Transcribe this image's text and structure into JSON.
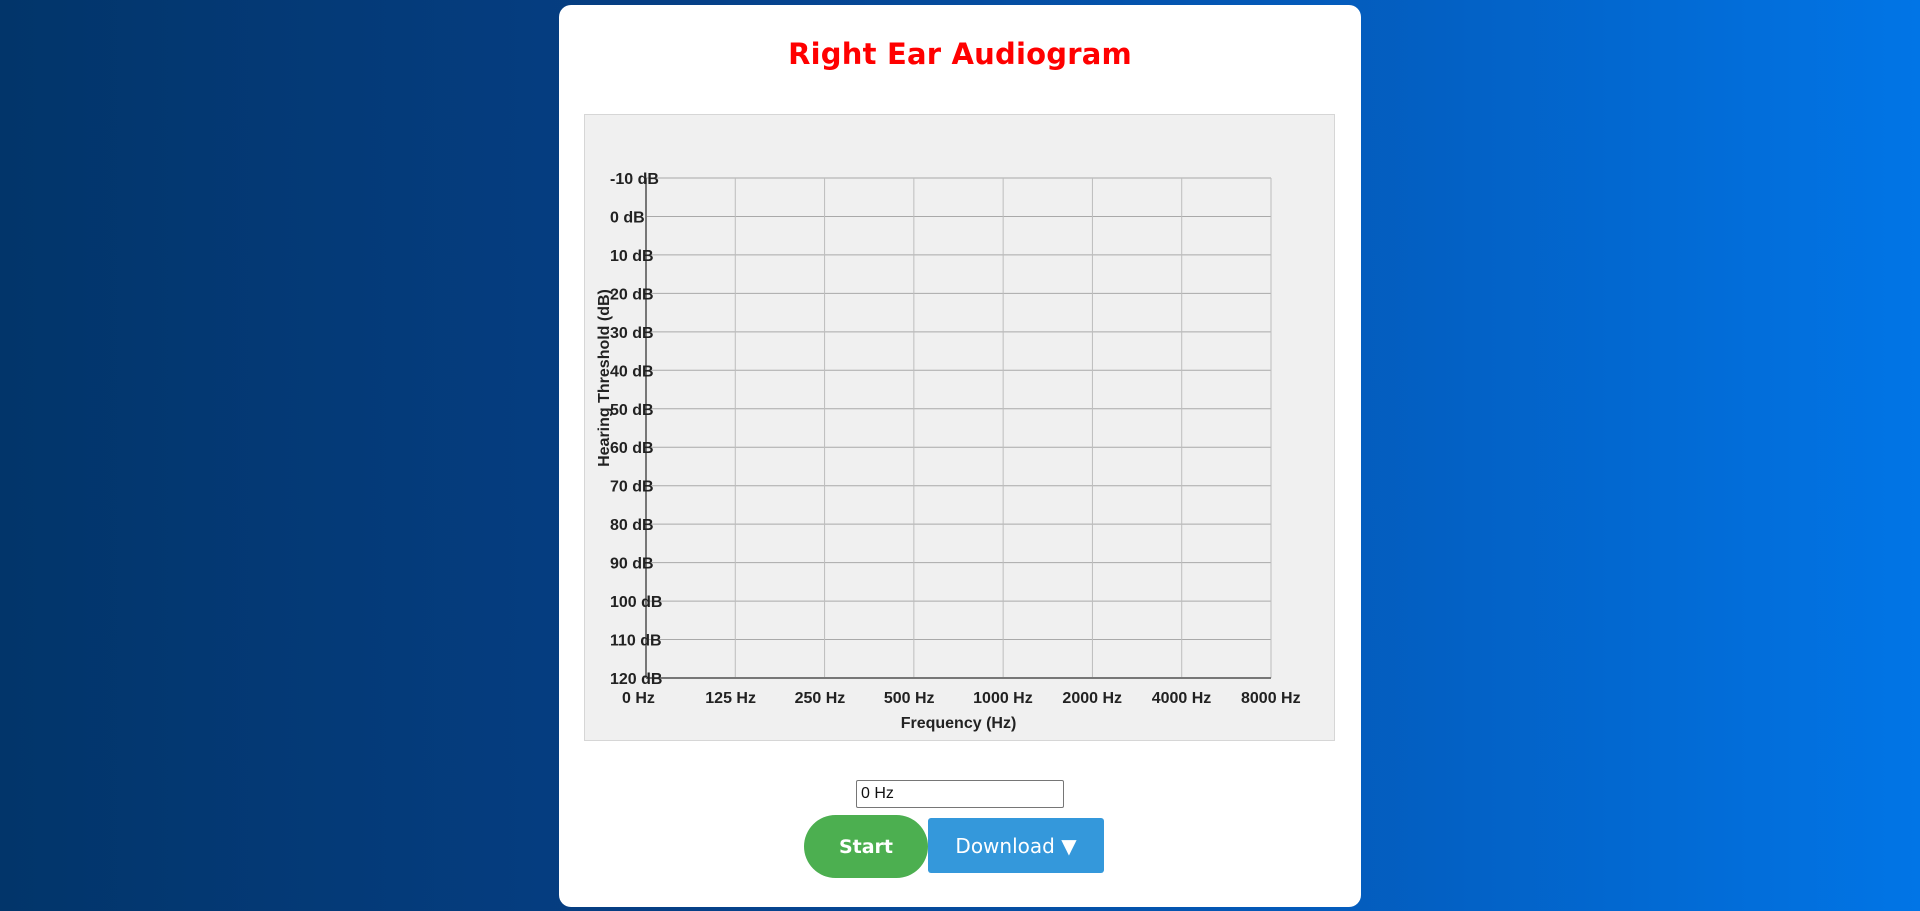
{
  "page": {
    "title": "Right Ear Audiogram"
  },
  "controls": {
    "frequency_value": "0 Hz",
    "start_label": "Start",
    "download_label": "Download ▼"
  },
  "colors": {
    "title": "#ff0000",
    "start_button": "#4caf50",
    "download_button": "#3498db",
    "chart_background": "#f0f0f0"
  },
  "chart_data": {
    "type": "line",
    "title": "",
    "xlabel": "Frequency (Hz)",
    "ylabel": "Hearing Threshold (dB)",
    "categories": [
      "0 Hz",
      "125 Hz",
      "250 Hz",
      "500 Hz",
      "1000 Hz",
      "2000 Hz",
      "4000 Hz",
      "8000 Hz"
    ],
    "y_ticks": [
      "-10 dB",
      "0 dB",
      "10 dB",
      "20 dB",
      "30 dB",
      "40 dB",
      "50 dB",
      "60 dB",
      "70 dB",
      "80 dB",
      "90 dB",
      "100 dB",
      "110 dB",
      "120 dB"
    ],
    "ylim": [
      -10,
      120
    ],
    "y_inverted": true,
    "grid": true,
    "series": []
  }
}
